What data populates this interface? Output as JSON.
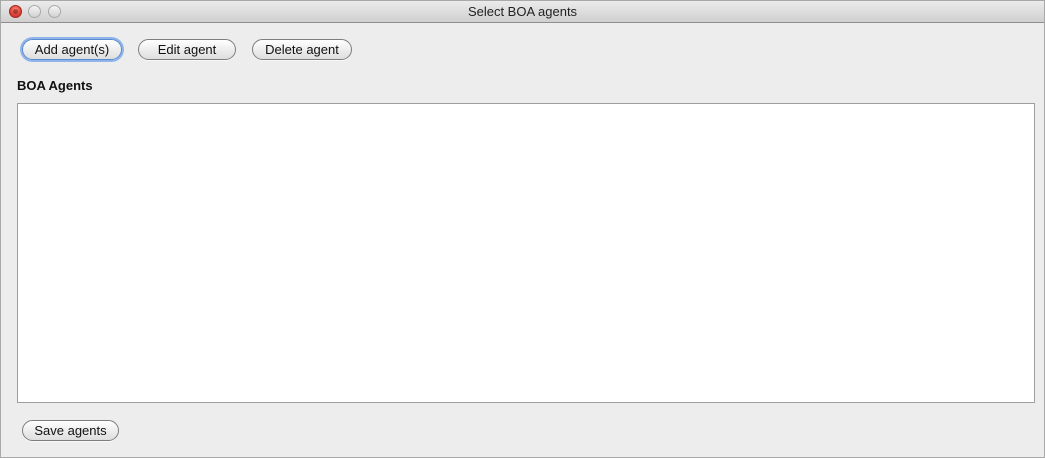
{
  "window": {
    "title": "Select BOA agents"
  },
  "toolbar": {
    "add_label": "Add agent(s)",
    "edit_label": "Edit agent",
    "delete_label": "Delete agent"
  },
  "agents_section": {
    "label": "BOA Agents",
    "items": []
  },
  "footer": {
    "save_label": "Save agents"
  }
}
